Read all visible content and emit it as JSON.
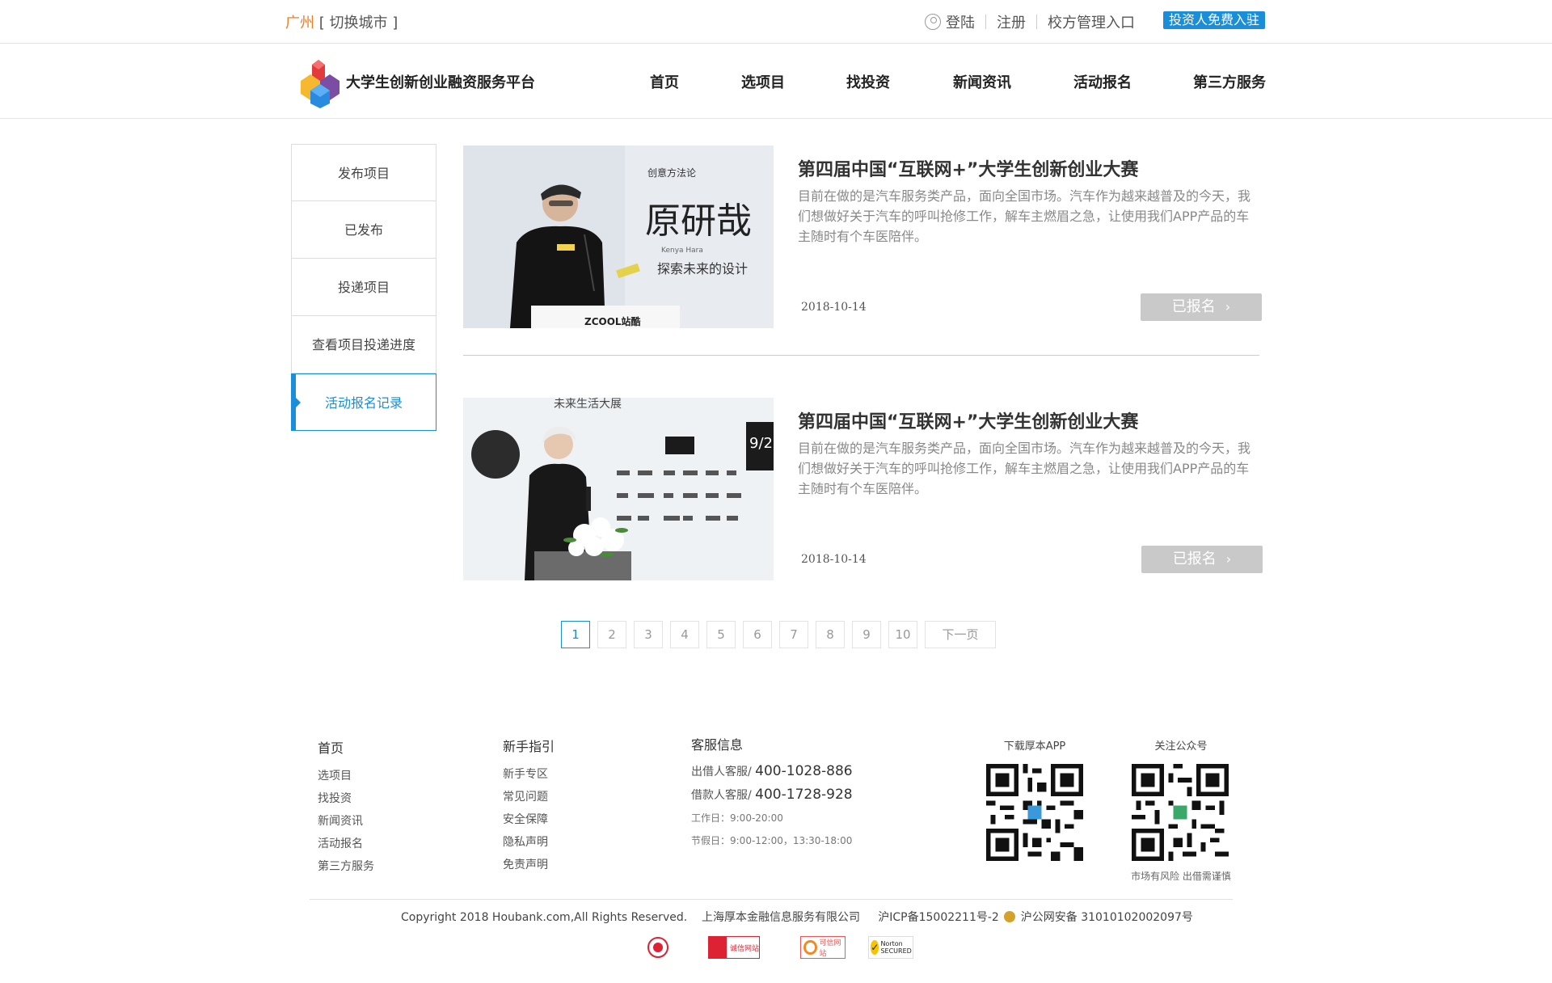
{
  "topbar": {
    "city_name": "广州",
    "city_switch": "[ 切换城市 ]",
    "login": "登陆",
    "register": "注册",
    "school_entry": "校方管理入口",
    "investor_btn": "投资人免费入驻"
  },
  "header": {
    "brand": "大学生创新创业融资服务平台",
    "nav": [
      "首页",
      "选项目",
      "找投资",
      "新闻资讯",
      "活动报名",
      "第三方服务"
    ]
  },
  "sidebar": {
    "items": [
      "发布项目",
      "已发布",
      "投递项目",
      "查看项目投递进度",
      "活动报名记录"
    ],
    "active_index": 4
  },
  "cards": [
    {
      "title": "第四届中国“互联网+”大学生创新创业大赛",
      "desc": "目前在做的是汽车服务类产品，面向全国市场。汽车作为越来越普及的今天，我们想做好关于汽车的呼叫抢修工作，解车主燃眉之急，让使用我们APP产品的车主随时有个车医陪伴。",
      "date": "2018-10-14",
      "button": "已报名",
      "image_text": {
        "big": "原研哉",
        "sub": "探索未来的设计",
        "top": "创意方法论",
        "en": "Kenya Hara",
        "podium": "ZCOOL站酷"
      }
    },
    {
      "title": "第四届中国“互联网+”大学生创新创业大赛",
      "desc": "目前在做的是汽车服务类产品，面向全国市场。汽车作为越来越普及的今天，我们想做好关于汽车的呼叫抢修工作，解车主燃眉之急，让使用我们APP产品的车主随时有个车医陪伴。",
      "date": "2018-10-14",
      "button": "已报名",
      "image_text": {
        "top": "未来生活大展",
        "date": "9/2"
      }
    }
  ],
  "pagination": {
    "pages": [
      "1",
      "2",
      "3",
      "4",
      "5",
      "6",
      "7",
      "8",
      "9",
      "10"
    ],
    "current": "1",
    "next": "下一页"
  },
  "footer": {
    "col1": {
      "head": "首页",
      "links": [
        "选项目",
        "找投资",
        "新闻资讯",
        "活动报名",
        "第三方服务"
      ]
    },
    "col2": {
      "head": "新手指引",
      "links": [
        "新手专区",
        "常见问题",
        "安全保障",
        "隐私声明",
        "免责声明"
      ]
    },
    "service": {
      "head": "客服信息",
      "lender_label": "出借人客服/",
      "lender_phone": "400-1028-886",
      "borrower_label": "借款人客服/",
      "borrower_phone": "400-1728-928",
      "workday": "工作日：9:00-20:00",
      "holiday": "节假日：9:00-12:00，13:30-18:00"
    },
    "app_label": "下载厚本APP",
    "wechat_label": "关注公众号",
    "risk_note": "市场有风险 出借需谨慎",
    "copyright": "Copyright 2018 Houbank.com,All Rights Reserved.",
    "company": "上海厚本金融信息服务有限公司",
    "icp": "沪ICP备15002211号-2",
    "police": "沪公网安备 31010102002097号",
    "badges": [
      "诚信网站",
      "可信网站",
      "Norton SECURED"
    ]
  },
  "colors": {
    "accent": "#1a8ed8",
    "city": "#f07d24",
    "registered_btn": "#c9c9c9"
  }
}
